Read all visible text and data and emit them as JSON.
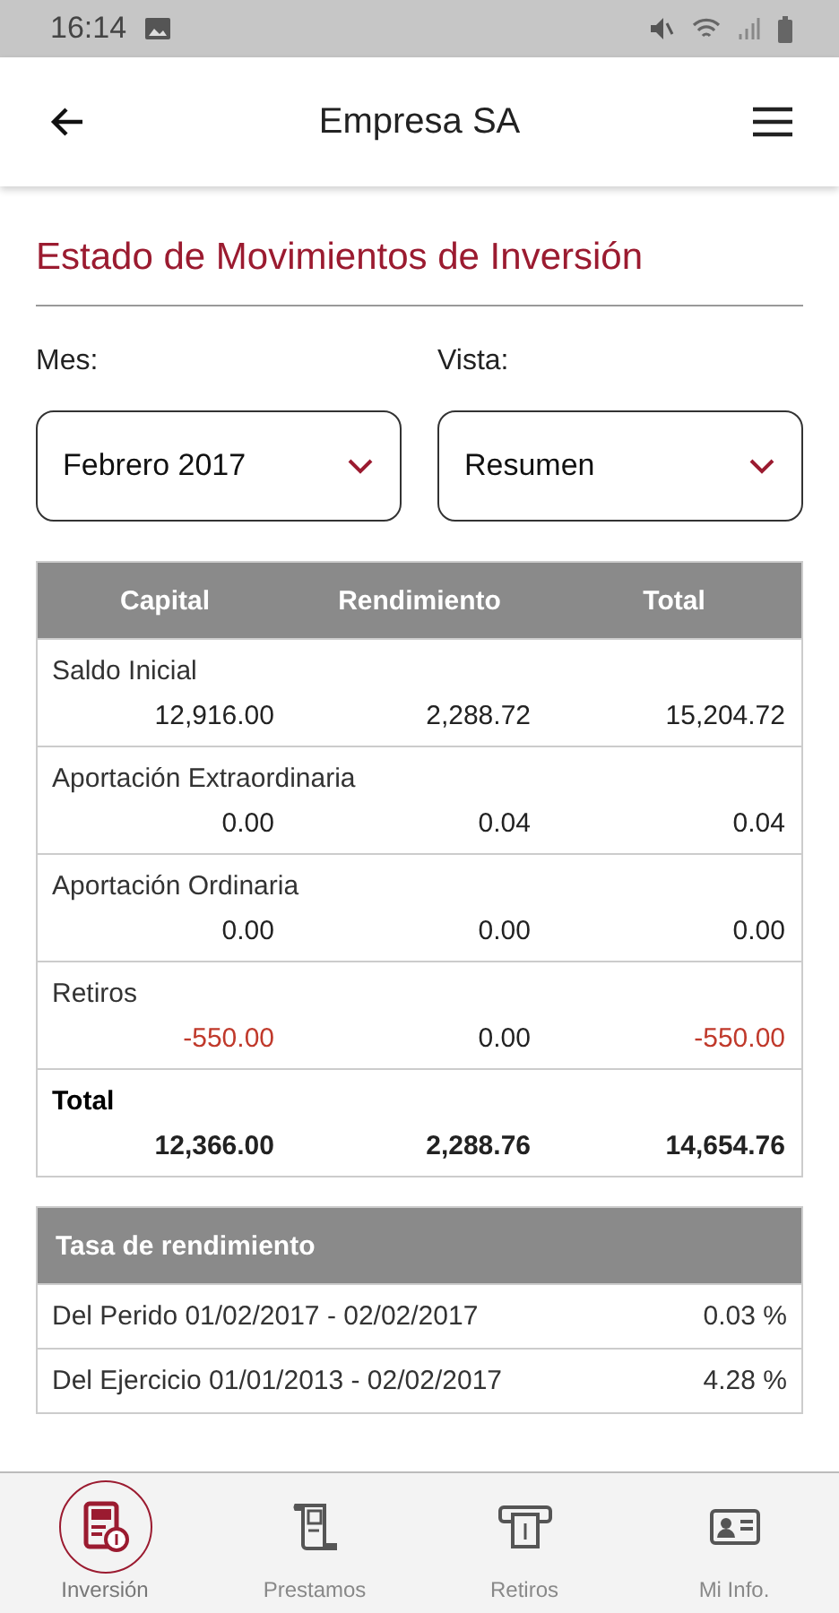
{
  "status_bar": {
    "time": "16:14"
  },
  "app_bar": {
    "title": "Empresa SA"
  },
  "page_title": "Estado de Movimientos de Inversión",
  "filters": [
    {
      "label": "Mes:",
      "value": "Febrero 2017"
    },
    {
      "label": "Vista:",
      "value": "Resumen"
    }
  ],
  "summary_table": {
    "columns": [
      "Capital",
      "Rendimiento",
      "Total"
    ],
    "rows": [
      {
        "kind": "item",
        "label": "Saldo Inicial",
        "values": [
          {
            "text": "12,916.00",
            "negative": false
          },
          {
            "text": "2,288.72",
            "negative": false
          },
          {
            "text": "15,204.72",
            "negative": false
          }
        ]
      },
      {
        "kind": "item",
        "label": "Aportación Extraordinaria",
        "values": [
          {
            "text": "0.00",
            "negative": false
          },
          {
            "text": "0.04",
            "negative": false
          },
          {
            "text": "0.04",
            "negative": false
          }
        ]
      },
      {
        "kind": "item",
        "label": "Aportación Ordinaria",
        "values": [
          {
            "text": "0.00",
            "negative": false
          },
          {
            "text": "0.00",
            "negative": false
          },
          {
            "text": "0.00",
            "negative": false
          }
        ]
      },
      {
        "kind": "item",
        "label": "Retiros",
        "values": [
          {
            "text": "-550.00",
            "negative": true
          },
          {
            "text": "0.00",
            "negative": false
          },
          {
            "text": "-550.00",
            "negative": true
          }
        ]
      },
      {
        "kind": "total",
        "label": "Total",
        "values": [
          {
            "text": "12,366.00",
            "negative": false
          },
          {
            "text": "2,288.76",
            "negative": false
          },
          {
            "text": "14,654.76",
            "negative": false
          }
        ]
      }
    ]
  },
  "rate_table": {
    "title": "Tasa de rendimiento",
    "rows": [
      {
        "label": "Del Perido 01/02/2017 - 02/02/2017",
        "value": "0.03 %"
      },
      {
        "label": "Del Ejercicio 01/01/2013 - 02/02/2017",
        "value": "4.28 %"
      }
    ]
  },
  "bottom_nav": [
    {
      "label": "Inversión",
      "kind": "statement",
      "selected": true
    },
    {
      "label": "Prestamos",
      "kind": "scroll",
      "selected": false
    },
    {
      "label": "Retiros",
      "kind": "atm",
      "selected": false
    },
    {
      "label": "Mi Info.",
      "kind": "id",
      "selected": false
    }
  ]
}
